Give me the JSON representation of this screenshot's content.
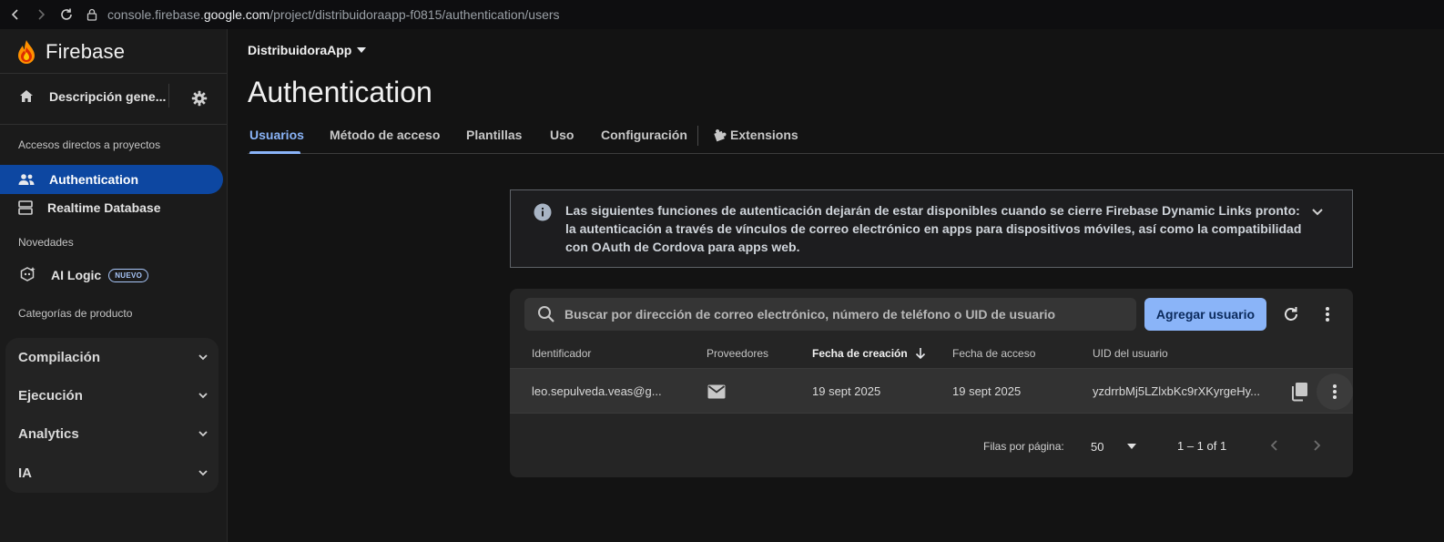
{
  "browser": {
    "url_prefix": "console.firebase.",
    "url_host": "google.com",
    "url_path": "/project/distribuidoraapp-f0815/authentication/users"
  },
  "sidebar": {
    "brand": "Firebase",
    "overview_label": "Descripción gene...",
    "shortcuts_label": "Accesos directos a proyectos",
    "shortcuts": [
      {
        "label": "Authentication",
        "icon": "people-icon",
        "active": true
      },
      {
        "label": "Realtime Database",
        "icon": "database-icon",
        "active": false
      }
    ],
    "news_label": "Novedades",
    "news_item": {
      "label": "AI Logic",
      "badge": "NUEVO",
      "icon": "ai-logic-icon"
    },
    "categories_label": "Categorías de producto",
    "categories": [
      "Compilación",
      "Ejecución",
      "Analytics",
      "IA"
    ]
  },
  "main": {
    "project_name": "DistribuidoraApp",
    "title": "Authentication",
    "tabs": [
      "Usuarios",
      "Método de acceso",
      "Plantillas",
      "Uso",
      "Configuración",
      "Extensions"
    ],
    "active_tab": "Usuarios",
    "banner_text": "Las siguientes funciones de autenticación dejarán de estar disponibles cuando se cierre Firebase Dynamic Links pronto: la autenticación a través de vínculos de correo electrónico en apps para dispositivos móviles, así como la compatibilidad con OAuth de Cordova para apps web.",
    "search_placeholder": "Buscar por dirección de correo electrónico, número de teléfono o UID de usuario",
    "add_user_label": "Agregar usuario",
    "columns": [
      "Identificador",
      "Proveedores",
      "Fecha de creación",
      "Fecha de acceso",
      "UID del usuario"
    ],
    "sorted_column": "Fecha de creación",
    "rows": [
      {
        "identifier": "leo.sepulveda.veas@g...",
        "provider": "email",
        "created": "19 sept 2025",
        "signed_in": "19 sept 2025",
        "uid": "yzdrrbMj5LZlxbKc9rXKyrgeHy..."
      }
    ],
    "pagination": {
      "rows_per_page_label": "Filas por página:",
      "rows_per_page": "50",
      "range": "1 – 1 of 1"
    }
  },
  "colors": {
    "accent": "#8ab4f8",
    "active_nav": "#0d47a1",
    "background": "#131313"
  }
}
